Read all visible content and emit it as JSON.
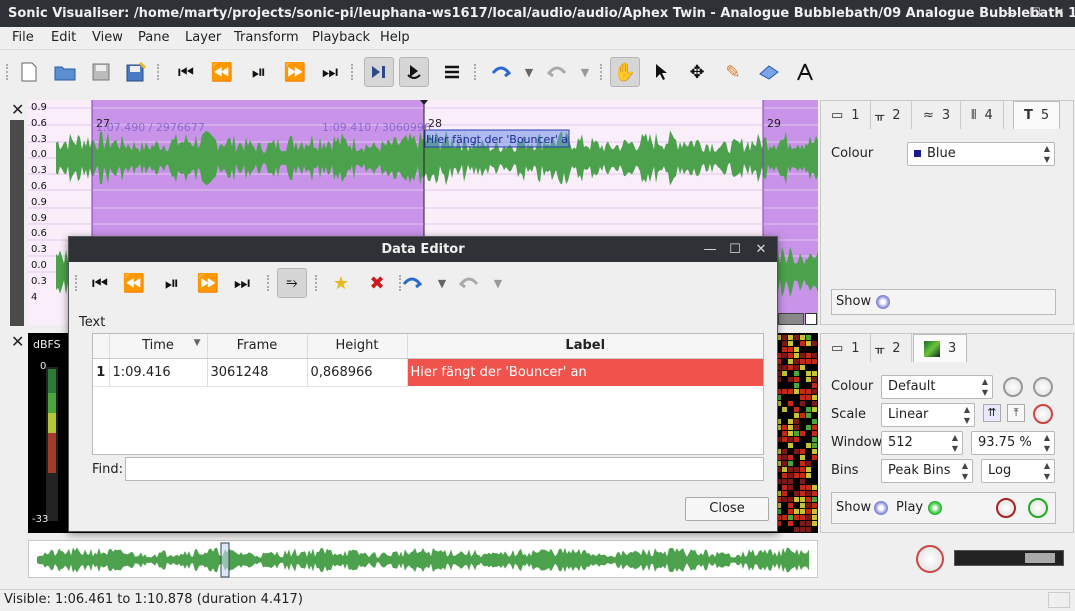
{
  "window": {
    "title": "Sonic Visualiser: /home/marty/projects/sonic-pi/leuphana-ws1617/local/audio/audio/Aphex Twin - Analogue Bubblebath/09 Analogue Bubblebath 1...."
  },
  "menu": [
    "File",
    "Edit",
    "View",
    "Pane",
    "Layer",
    "Transform",
    "Playback",
    "Help"
  ],
  "toolbar_icons": [
    "new-file-icon",
    "open-file-icon",
    "save-icon",
    "save-session-icon",
    "rewind-start-icon",
    "rewind-icon",
    "play-pause-icon",
    "fast-forward-icon",
    "fast-forward-end-icon",
    "play-selection-icon",
    "looping-icon",
    "solo-icon",
    "undo-icon",
    "undo-dropdown-icon",
    "redo-icon",
    "redo-dropdown-icon",
    "navigate-hand-icon",
    "select-arrow-icon",
    "move-icon",
    "draw-pencil-icon",
    "erase-icon",
    "measure-icon"
  ],
  "pane1": {
    "markers": [
      "27",
      "28",
      "29"
    ],
    "time_labels": [
      "1:07.490 / 2976677",
      "1:09.410 / 3060996"
    ],
    "scale_top": [
      "0.9",
      "0.6",
      "0.3",
      "0.0",
      "0.3",
      "0.6",
      "0.9"
    ],
    "scale_bottom": [
      "0.9",
      "0.6",
      "0.3",
      "0.0",
      "0.3",
      "4"
    ],
    "text_label": "Hier fängt der 'Bouncer' an"
  },
  "pane2": {
    "unit": "dBFS",
    "scale_top": "0",
    "scale_bottom": "-33"
  },
  "right_panel_1": {
    "tabs": [
      "1",
      "2",
      "3",
      "4",
      "5"
    ],
    "colour_label": "Colour",
    "colour_value": "Blue",
    "show_label": "Show"
  },
  "right_panel_2": {
    "tabs": [
      "1",
      "2",
      "3"
    ],
    "colour_label": "Colour",
    "colour_value": "Default",
    "scale_label": "Scale",
    "scale_value": "Linear",
    "window_label": "Window",
    "window_value": "512",
    "overlap_value": "93.75 %",
    "bins_label": "Bins",
    "bins_value": "Peak Bins",
    "bins_scale": "Log",
    "show_label": "Show",
    "play_label": "Play"
  },
  "dialog": {
    "title": "Data Editor",
    "section_label": "Text",
    "columns": [
      "Time",
      "Frame",
      "Height",
      "Label"
    ],
    "rows": [
      {
        "index": "1",
        "time": "1:09.416",
        "frame": "3061248",
        "height": "0,868966",
        "label": "Hier fängt der 'Bouncer' an"
      }
    ],
    "find_label": "Find:",
    "close_label": "Close"
  },
  "status": {
    "text": "Visible: 1:06.461 to 1:10.878 (duration 4.417)"
  },
  "colors": {
    "selection": "#c993ea",
    "waveform": "#4ca24c",
    "highlight": "#f0524c",
    "dark": "#2e3136"
  }
}
